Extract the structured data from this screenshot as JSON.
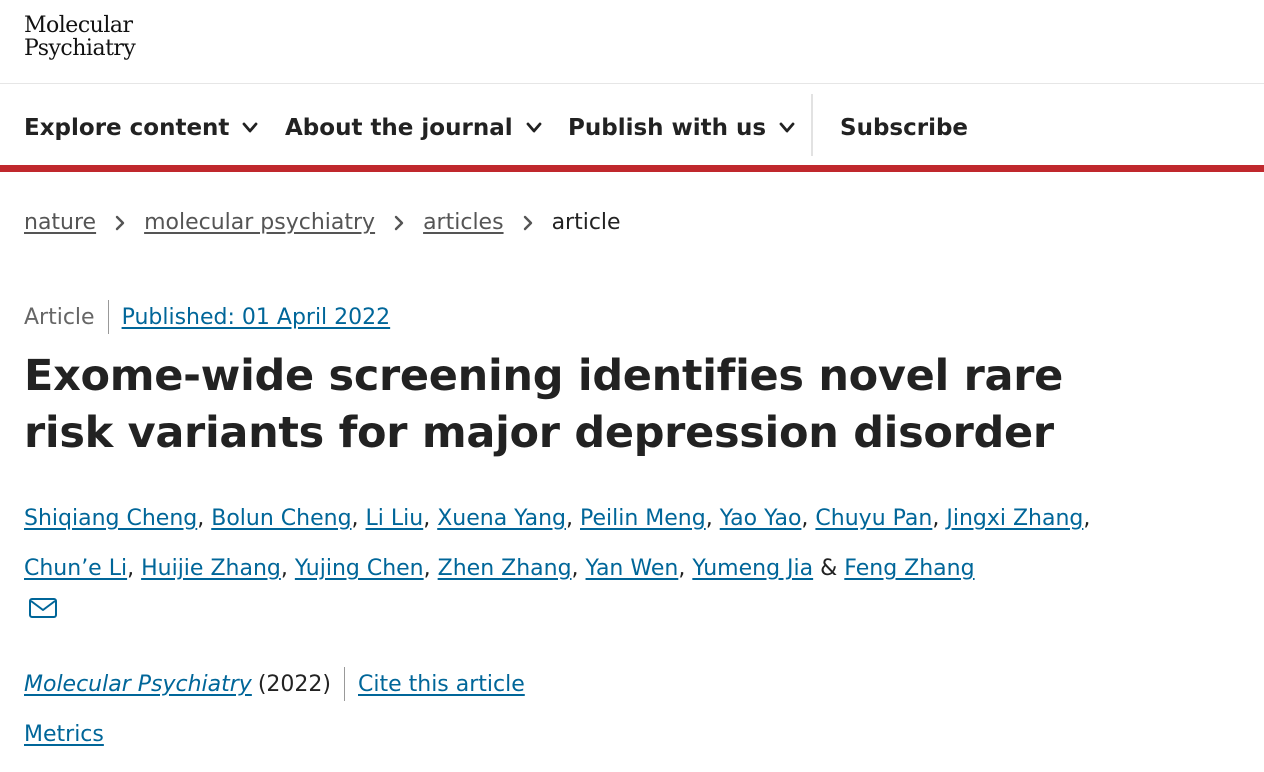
{
  "header": {
    "logo_line1": "Molecular",
    "logo_line2": "Psychiatry"
  },
  "nav": {
    "items": [
      {
        "label": "Explore content",
        "icon": "chevron-down-icon"
      },
      {
        "label": "About the journal",
        "icon": "chevron-down-icon"
      },
      {
        "label": "Publish with us",
        "icon": "chevron-down-icon"
      }
    ],
    "subscribe": "Subscribe",
    "accent_color": "#c0282d"
  },
  "breadcrumb": {
    "items": [
      "nature",
      "molecular psychiatry",
      "articles"
    ],
    "current": "article",
    "separator_icon": "chevron-right-icon"
  },
  "article": {
    "type": "Article",
    "published": "Published: 01 April 2022",
    "title": "Exome-wide screening identifies novel rare risk variants for major depression disorder",
    "authors": [
      "Shiqiang Cheng",
      "Bolun Cheng",
      "Li Liu",
      "Xuena Yang",
      "Peilin Meng",
      "Yao Yao",
      "Chuyu Pan",
      "Jingxi Zhang",
      "Chun’e Li",
      "Huijie Zhang",
      "Yujing Chen",
      "Zhen Zhang",
      "Yan Wen",
      "Yumeng Jia",
      "Feng Zhang"
    ],
    "author_separator": ", ",
    "author_final_separator": " & ",
    "contact_icon": "mail-icon",
    "journal": "Molecular Psychiatry",
    "year": "(2022)",
    "cite_label": "Cite this article",
    "metrics_label": "Metrics",
    "link_color": "#006699"
  }
}
